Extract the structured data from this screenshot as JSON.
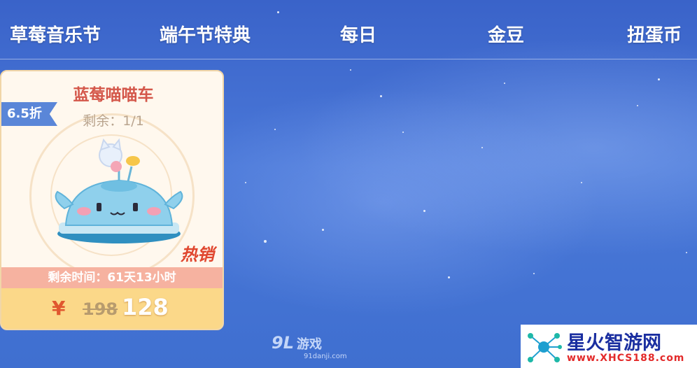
{
  "tabs": [
    {
      "label": "草莓音乐节"
    },
    {
      "label": "端午节特典"
    },
    {
      "label": "每日"
    },
    {
      "label": "金豆"
    },
    {
      "label": "扭蛋币"
    }
  ],
  "item_card": {
    "name": "蓝莓喵喵车",
    "stock": "剩余：1/1",
    "discount": "6.5折",
    "hot_label": "热销",
    "time_remaining": "剩余时间：61天13小时",
    "currency_symbol": "¥",
    "original_price": "198",
    "price": "128"
  },
  "watermarks": {
    "game_site": {
      "logo_text": "9L",
      "name": "游戏",
      "url": "91danji.com"
    },
    "brand": {
      "title": "星火智游网",
      "url": "www.XHCS188.com"
    }
  },
  "colors": {
    "accent_red": "#d4574a",
    "discount_blue": "#5a86d8",
    "price_bar": "#fbd889",
    "time_bar": "#f6b2a0"
  }
}
